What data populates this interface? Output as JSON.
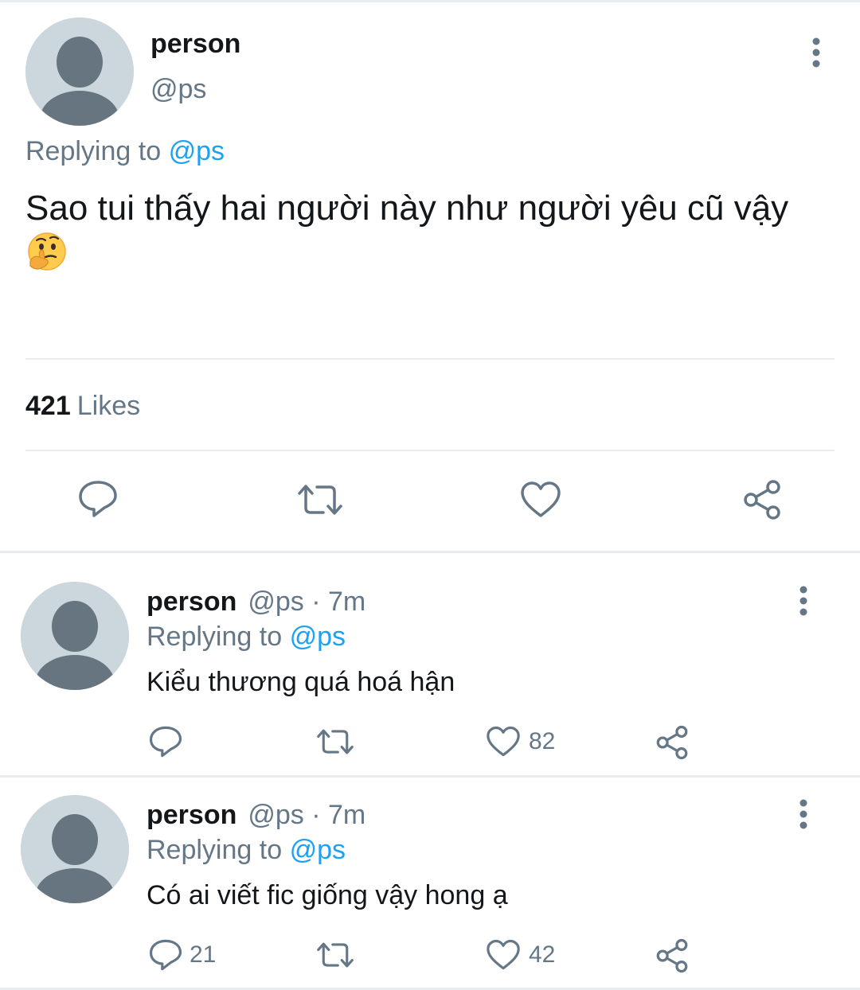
{
  "main_tweet": {
    "name": "person",
    "handle": "@ps",
    "replying_prefix": "Replying to",
    "replying_handle": "@ps",
    "text": "Sao tui thấy hai người này như người yêu cũ vậy",
    "emoji": "thinking-face",
    "likes_count": "421",
    "likes_label": "Likes"
  },
  "replies": [
    {
      "name": "person",
      "meta": "@ps · 7m",
      "replying_prefix": "Replying to",
      "replying_handle": "@ps",
      "text": "Kiểu thương quá hoá hận",
      "reply_count": "",
      "like_count": "82"
    },
    {
      "name": "person",
      "meta": "@ps · 7m",
      "replying_prefix": "Replying to",
      "replying_handle": "@ps",
      "text": "Có ai viết fic giống vậy hong ạ",
      "reply_count": "21",
      "like_count": "42"
    }
  ],
  "colors": {
    "text_primary": "#14171a",
    "text_secondary": "#657786",
    "accent": "#1da1f2",
    "divider": "#e6ecf0",
    "avatar_bg": "#ccd6dd",
    "avatar_fg": "#66757f"
  },
  "icons": [
    "more-vertical-icon",
    "reply-icon",
    "retweet-icon",
    "like-icon",
    "share-icon",
    "thinking-face-emoji",
    "default-avatar-icon"
  ]
}
